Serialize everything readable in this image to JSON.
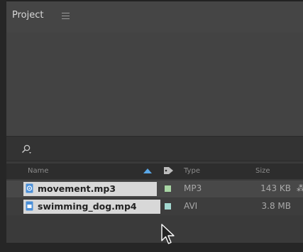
{
  "panel": {
    "title": "Project"
  },
  "search": {
    "value": "",
    "placeholder": ""
  },
  "columns": {
    "name": "Name",
    "type": "Type",
    "size": "Size"
  },
  "files": [
    {
      "name": "movement.mp3",
      "icon": "audio-file-icon",
      "type": "MP3",
      "size": "143 KB",
      "label_color": "#a8d6a4"
    },
    {
      "name": "swimming_dog.mp4",
      "icon": "video-file-icon",
      "type": "AVI",
      "size": "3.8 MB",
      "label_color": "#a3d8d0"
    }
  ],
  "colors": {
    "selection": "#d8d8d8",
    "file_icon": "#4a8fd8"
  }
}
